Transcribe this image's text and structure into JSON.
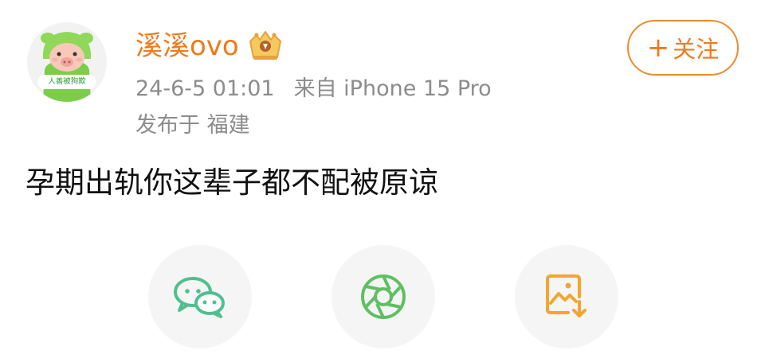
{
  "post": {
    "username": "溪溪ovo",
    "timestamp": "24-6-5 01:01",
    "source": "来自 iPhone 15 Pro",
    "location": "发布于 福建",
    "content": "孕期出轨你这辈子都不配被原谅"
  },
  "avatar": {
    "badge_text": "人善被狗欺"
  },
  "follow": {
    "plus": "+",
    "label": "关注"
  },
  "share": [
    {
      "icon": "wechat-icon",
      "color": "#4fc08d"
    },
    {
      "icon": "moments-icon",
      "color": "#5fbf62"
    },
    {
      "icon": "save-image-icon",
      "color": "#f2a62d"
    }
  ],
  "colors": {
    "username": "#f07a18",
    "follow_border": "#ef8a2d",
    "meta": "#8c8c8c",
    "text": "#111111"
  }
}
